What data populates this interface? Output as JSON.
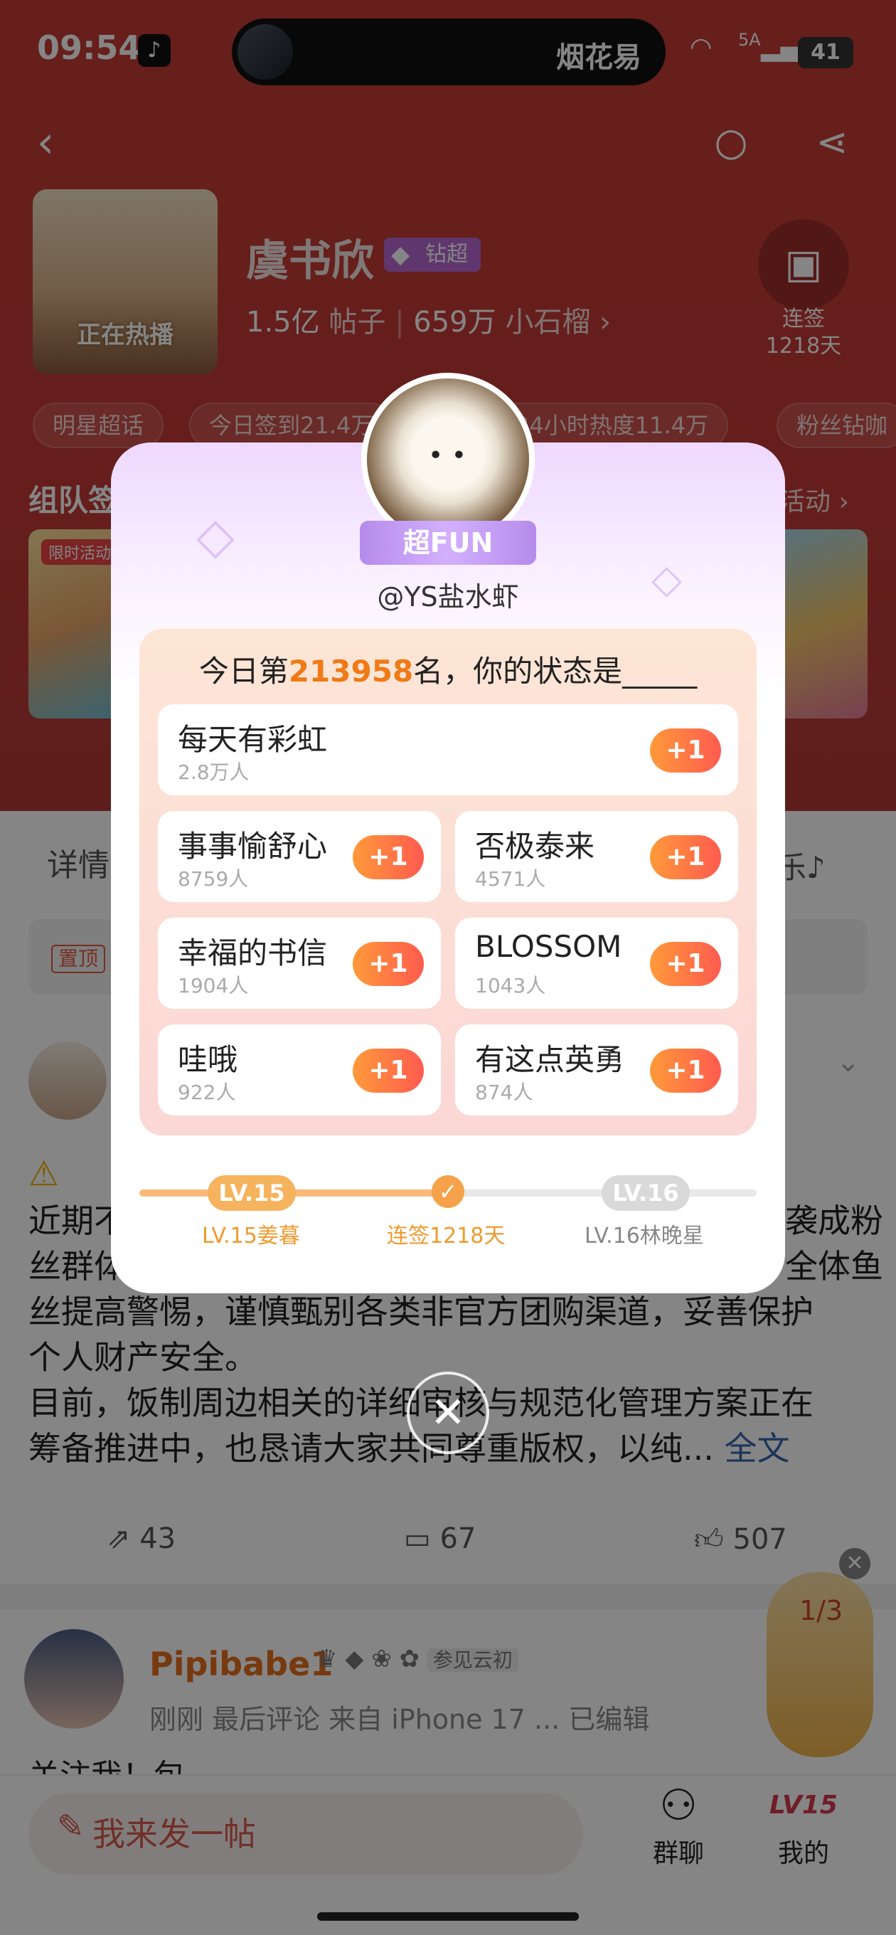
{
  "status": {
    "time": "09:54",
    "island_text": "烟花易",
    "network": "5A",
    "battery": "41"
  },
  "header": {
    "back_icon": "back-icon",
    "search_icon": "search-icon",
    "share_icon": "share-icon"
  },
  "profile": {
    "cover_badge": "正在热播",
    "name": "虞书欣",
    "badge_label": "钻超",
    "posts_count": "1.5亿",
    "posts_label": "帖子",
    "fans_count": "659万",
    "fans_label": "小石榴",
    "signin_label": "连签",
    "signin_days": "1218天"
  },
  "chips": [
    "明星超话",
    "今日签到21.4万",
    "24小时热度11.4万",
    "粉丝钻咖"
  ],
  "section": {
    "title": "组队签",
    "more": "活动",
    "card_tag": "限时活动"
  },
  "tabs": {
    "first": "详情",
    "last": "乐"
  },
  "pinned": {
    "tag": "置顶"
  },
  "post": {
    "text_lines": [
      "近期不",
      "丝群体",
      "丝提高警惕，谨慎甄别各类非官方团购渠道，妥善保护",
      "个人财产安全。",
      "目前，饭制周边相关的详细审核与规范化管理方案正在",
      "筹备推进中，也恳请大家共同尊重版权，以纯..."
    ],
    "text_right_1": "袭成粉",
    "text_right_2": "全体鱼",
    "more_label": "全文",
    "shares": "43",
    "comments": "67",
    "likes": "507"
  },
  "post2": {
    "name": "Pipibabe1",
    "badge_text": "参见云初",
    "meta": "刚刚 最后评论  来自 iPhone 17 ...  已编辑",
    "preview": "关注我！包"
  },
  "redpack": {
    "count": "1/3"
  },
  "bottom": {
    "compose": "我来发一帖",
    "group_chat": "群聊",
    "mine": "我的",
    "mine_level": "LV15"
  },
  "modal": {
    "ribbon": "超FUN",
    "handle": "@YS盐水虾",
    "title_prefix": "今日第",
    "rank": "213958",
    "title_suffix": "名，你的状态是_____",
    "plus_label": "+1",
    "options": [
      {
        "label": "每天有彩虹",
        "count": "2.8万人"
      },
      {
        "label": "事事愉舒心",
        "count": "8759人"
      },
      {
        "label": "否极泰来",
        "count": "4571人"
      },
      {
        "label": "幸福的书信",
        "count": "1904人"
      },
      {
        "label": "BLOSSOM",
        "count": "1043人"
      },
      {
        "label": "哇哦",
        "count": "922人"
      },
      {
        "label": "有这点英勇",
        "count": "874人"
      }
    ],
    "level_current": "LV.15",
    "level_next": "LV.16",
    "level_current_label": "LV.15姜暮",
    "streak_label": "连签1218天",
    "level_next_label": "LV.16林晚星",
    "progress_fraction": 0.52
  },
  "colors": {
    "brand_red": "#c63d35",
    "accent_orange": "#ef7a16",
    "ribbon_purple": "#b58bea"
  }
}
